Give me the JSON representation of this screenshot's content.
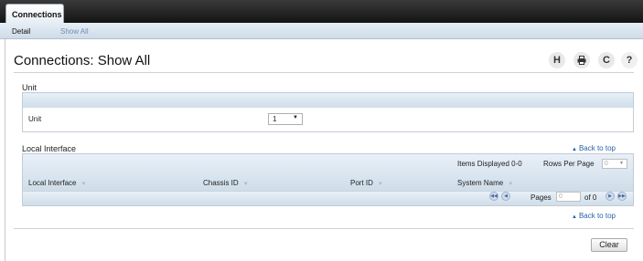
{
  "topbar": {
    "active_tab": "Connections"
  },
  "subnav": {
    "detail": "Detail",
    "show_all": "Show All"
  },
  "page": {
    "title": "Connections: Show All"
  },
  "tools": {
    "save_icon": "H",
    "print_icon": "printer-icon",
    "refresh_icon": "C",
    "help_icon": "?"
  },
  "unit_section": {
    "heading": "Unit",
    "row_label": "Unit",
    "select_value": "1"
  },
  "local_interface_section": {
    "heading": "Local Interface",
    "back_to_top": "Back to top",
    "items_displayed": "Items Displayed 0-0",
    "rows_per_page_label": "Rows Per Page",
    "rows_per_page_value": "0",
    "columns": [
      "Local Interface",
      "Chassis ID",
      "Port ID",
      "System Name"
    ],
    "pages_label": "Pages",
    "pages_value": "0",
    "pages_of": "of 0",
    "back_to_top_bottom": "Back to top"
  },
  "footer": {
    "clear_label": "Clear"
  }
}
